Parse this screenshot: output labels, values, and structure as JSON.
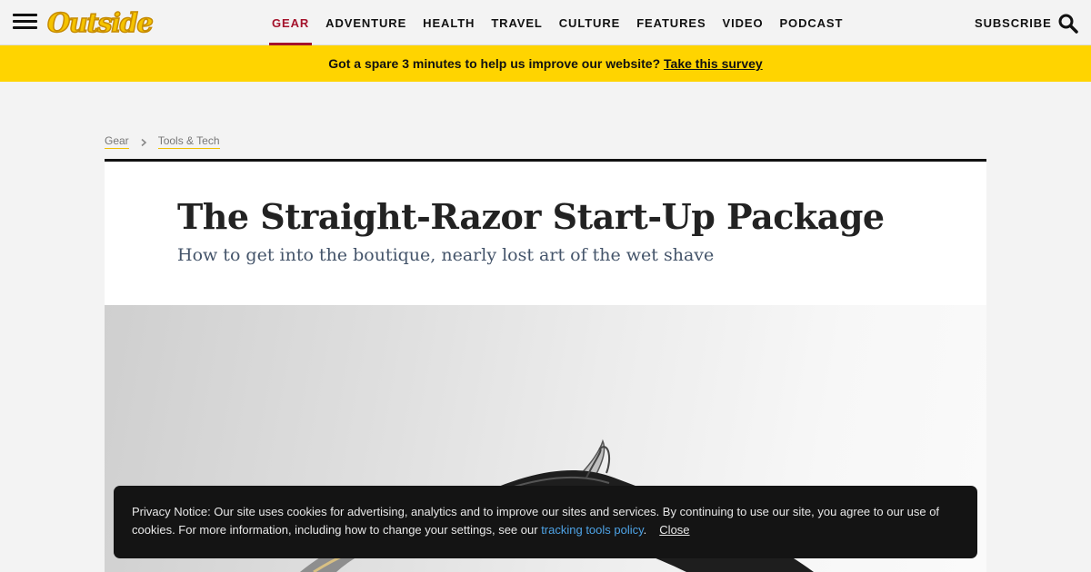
{
  "header": {
    "menu_icon": "hamburger-menu-icon",
    "logo_text": "Outside",
    "nav": [
      {
        "label": "GEAR",
        "active": true
      },
      {
        "label": "ADVENTURE"
      },
      {
        "label": "HEALTH"
      },
      {
        "label": "TRAVEL"
      },
      {
        "label": "CULTURE"
      },
      {
        "label": "FEATURES"
      },
      {
        "label": "VIDEO"
      },
      {
        "label": "PODCAST"
      }
    ],
    "subscribe_label": "SUBSCRIBE",
    "search_icon": "search-icon",
    "accent_color": "#a4122b"
  },
  "survey": {
    "text": "Got a spare 3 minutes to help us improve our website?",
    "link_text": "Take this survey",
    "background": "#ffd400"
  },
  "breadcrumb": {
    "items": [
      "Gear",
      "Tools & Tech"
    ],
    "separator_icon": "chevron-right-icon"
  },
  "article": {
    "title": "The Straight-Razor Start-Up Package",
    "subtitle": "How to get into the boutique, nearly lost art of the wet shave",
    "hero_image": "straight razor photo"
  },
  "privacy_notice": {
    "text_before": "Privacy Notice: Our site uses cookies for advertising, analytics and to improve our sites and services. By continuing to use our site, you agree to our use of cookies. For more information, including how to change your settings, see our ",
    "link_text": "tracking tools policy",
    "text_after": ".",
    "close_label": "Close"
  }
}
